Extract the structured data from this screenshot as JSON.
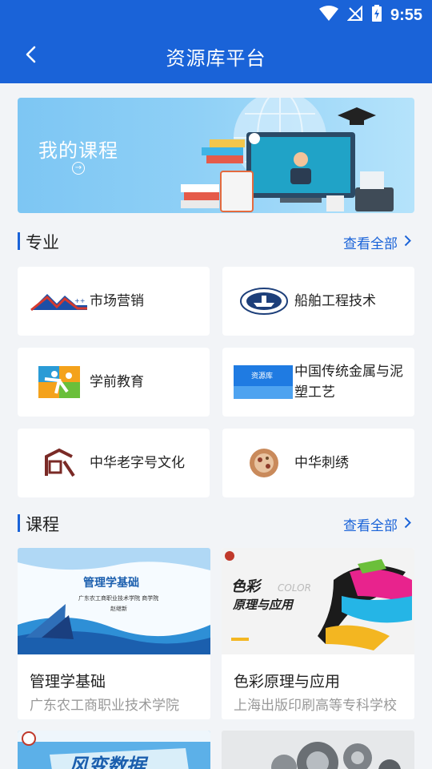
{
  "status_bar": {
    "time": "9:55"
  },
  "app_bar": {
    "title": "资源库平台",
    "back_icon": "back-arrow-icon"
  },
  "banner": {
    "title": "我的课程"
  },
  "majors": {
    "heading": "专业",
    "more": "查看全部",
    "items": [
      {
        "label": "市场营销"
      },
      {
        "label": "船舶工程技术"
      },
      {
        "label": "学前教育"
      },
      {
        "label": "中国传统金属与泥塑工艺"
      },
      {
        "label": "中华老字号文化"
      },
      {
        "label": "中华刺绣"
      }
    ]
  },
  "courses": {
    "heading": "课程",
    "more": "查看全部",
    "items": [
      {
        "name": "管理学基础",
        "school": "广东农工商职业技术学院",
        "thumb_title": "管理学基础",
        "thumb_sub": "广东农工商职业技术学院  商学院",
        "thumb_author": "赵继新"
      },
      {
        "name": "色彩原理与应用",
        "school": "上海出版印刷高等专科学校",
        "thumb_title_1": "色彩",
        "thumb_title_2": "原理与应用",
        "thumb_watermark": "COLOR"
      },
      {
        "name": "",
        "school": "",
        "thumb_title": "风变数据"
      },
      {
        "name": "",
        "school": ""
      }
    ]
  }
}
